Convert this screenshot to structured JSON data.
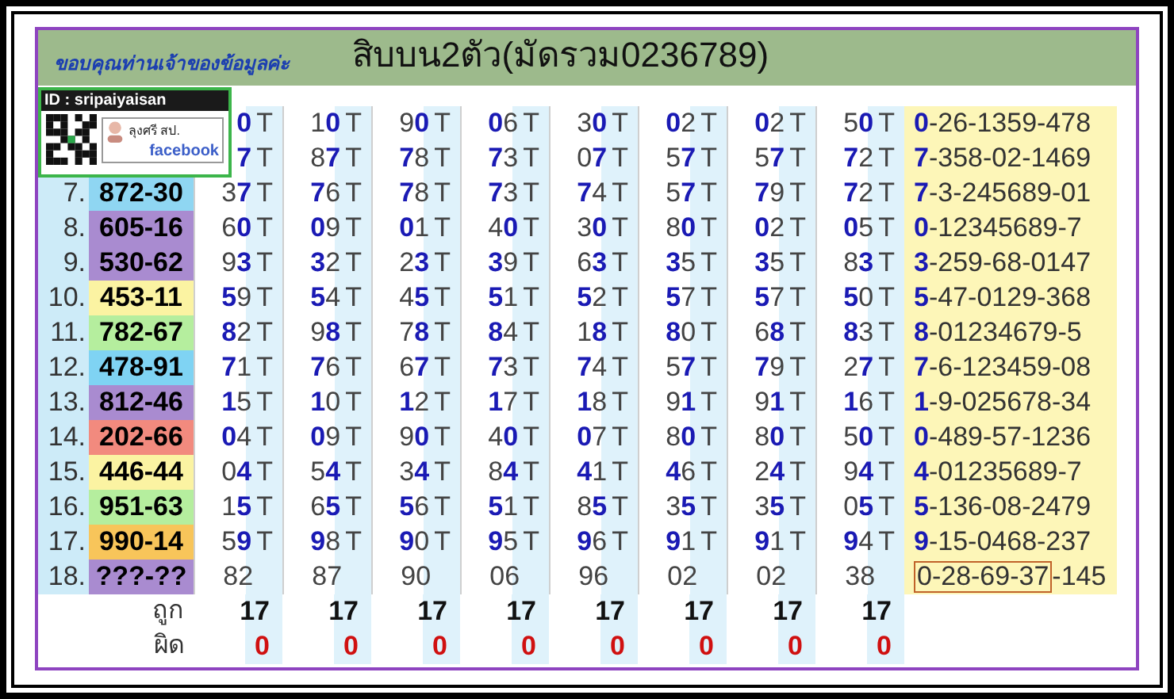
{
  "header": {
    "credit": "ขอบคุณท่านเจ้าของข้อมูลค่ะ",
    "title": "สิบบน2ตัว(มัดรวม0236789)"
  },
  "badge": {
    "id": "ID : sripaiyaisan",
    "name": "ลุงศรี สป.",
    "network": "facebook"
  },
  "rows": [
    {
      "cells": [
        {
          "text": "**0**",
          "mark": "T"
        },
        {
          "text": "1**0**",
          "mark": "T"
        },
        {
          "text": "9**0**",
          "mark": "T"
        },
        {
          "text": "**0**6",
          "mark": "T"
        },
        {
          "text": "3**0**",
          "mark": "T"
        },
        {
          "text": "**0**2",
          "mark": "T"
        },
        {
          "text": "**0**2",
          "mark": "T"
        },
        {
          "text": "5**0**",
          "mark": "T"
        }
      ],
      "result": "**0**-26-1359-478"
    },
    {
      "cells": [
        {
          "text": "**7**",
          "mark": "T"
        },
        {
          "text": "8**7**",
          "mark": "T"
        },
        {
          "text": "**7**8",
          "mark": "T"
        },
        {
          "text": "**7**3",
          "mark": "T"
        },
        {
          "text": "0**7**",
          "mark": "T"
        },
        {
          "text": "5**7**",
          "mark": "T"
        },
        {
          "text": "5**7**",
          "mark": "T"
        },
        {
          "text": "**7**2",
          "mark": "T"
        }
      ],
      "result": "**7**-358-02-1469"
    },
    {
      "index": "7.",
      "number": "872-30",
      "color": "#8fd6f2",
      "cells": [
        {
          "text": "3**7**",
          "mark": "T"
        },
        {
          "text": "**7**6",
          "mark": "T"
        },
        {
          "text": "**7**8",
          "mark": "T"
        },
        {
          "text": "**7**3",
          "mark": "T"
        },
        {
          "text": "**7**4",
          "mark": "T"
        },
        {
          "text": "5**7**",
          "mark": "T"
        },
        {
          "text": "**7**9",
          "mark": "T"
        },
        {
          "text": "**7**2",
          "mark": "T"
        }
      ],
      "result": "**7**-3-245689-01"
    },
    {
      "index": "8.",
      "number": "605-16",
      "color": "#a98bd0",
      "cells": [
        {
          "text": "6**0**",
          "mark": "T"
        },
        {
          "text": "**0**9",
          "mark": "T"
        },
        {
          "text": "**0**1",
          "mark": "T"
        },
        {
          "text": "4**0**",
          "mark": "T"
        },
        {
          "text": "3**0**",
          "mark": "T"
        },
        {
          "text": "8**0**",
          "mark": "T"
        },
        {
          "text": "**0**2",
          "mark": "T"
        },
        {
          "text": "**0**5",
          "mark": "T"
        }
      ],
      "result": "**0**-12345689-7"
    },
    {
      "index": "9.",
      "number": "530-62",
      "color": "#a98bd0",
      "cells": [
        {
          "text": "9**3**",
          "mark": "T"
        },
        {
          "text": "**3**2",
          "mark": "T"
        },
        {
          "text": "2**3**",
          "mark": "T"
        },
        {
          "text": "**3**9",
          "mark": "T"
        },
        {
          "text": "6**3**",
          "mark": "T"
        },
        {
          "text": "**3**5",
          "mark": "T"
        },
        {
          "text": "**3**5",
          "mark": "T"
        },
        {
          "text": "8**3**",
          "mark": "T"
        }
      ],
      "result": "**3**-259-68-0147"
    },
    {
      "index": "10.",
      "number": "453-11",
      "color": "#fbf3a2",
      "cells": [
        {
          "text": "**5**9",
          "mark": "T"
        },
        {
          "text": "**5**4",
          "mark": "T"
        },
        {
          "text": "4**5**",
          "mark": "T"
        },
        {
          "text": "**5**1",
          "mark": "T"
        },
        {
          "text": "**5**2",
          "mark": "T"
        },
        {
          "text": "**5**7",
          "mark": "T"
        },
        {
          "text": "**5**7",
          "mark": "T"
        },
        {
          "text": "**5**0",
          "mark": "T"
        }
      ],
      "result": "**5**-47-0129-368"
    },
    {
      "index": "11.",
      "number": "782-67",
      "color": "#b5ee9e",
      "cells": [
        {
          "text": "**8**2",
          "mark": "T"
        },
        {
          "text": "9**8**",
          "mark": "T"
        },
        {
          "text": "7**8**",
          "mark": "T"
        },
        {
          "text": "**8**4",
          "mark": "T"
        },
        {
          "text": "1**8**",
          "mark": "T"
        },
        {
          "text": "**8**0",
          "mark": "T"
        },
        {
          "text": "6**8**",
          "mark": "T"
        },
        {
          "text": "**8**3",
          "mark": "T"
        }
      ],
      "result": "**8**-01234679-5"
    },
    {
      "index": "12.",
      "number": "478-91",
      "color": "#7fd3f3",
      "cells": [
        {
          "text": "**7**1",
          "mark": "T"
        },
        {
          "text": "**7**6",
          "mark": "T"
        },
        {
          "text": "6**7**",
          "mark": "T"
        },
        {
          "text": "**7**3",
          "mark": "T"
        },
        {
          "text": "**7**4",
          "mark": "T"
        },
        {
          "text": "5**7**",
          "mark": "T"
        },
        {
          "text": "**7**9",
          "mark": "T"
        },
        {
          "text": "2**7**",
          "mark": "T"
        }
      ],
      "result": "**7**-6-123459-08"
    },
    {
      "index": "13.",
      "number": "812-46",
      "color": "#a98bd0",
      "cells": [
        {
          "text": "**1**5",
          "mark": "T"
        },
        {
          "text": "**1**0",
          "mark": "T"
        },
        {
          "text": "**1**2",
          "mark": "T"
        },
        {
          "text": "**1**7",
          "mark": "T"
        },
        {
          "text": "**1**8",
          "mark": "T"
        },
        {
          "text": "9**1**",
          "mark": "T"
        },
        {
          "text": "9**1**",
          "mark": "T"
        },
        {
          "text": "**1**6",
          "mark": "T"
        }
      ],
      "result": "**1**-9-025678-34"
    },
    {
      "index": "14.",
      "number": "202-66",
      "color": "#f28a7e",
      "cells": [
        {
          "text": "**0**4",
          "mark": "T"
        },
        {
          "text": "**0**9",
          "mark": "T"
        },
        {
          "text": "9**0**",
          "mark": "T"
        },
        {
          "text": "4**0**",
          "mark": "T"
        },
        {
          "text": "**0**7",
          "mark": "T"
        },
        {
          "text": "8**0**",
          "mark": "T"
        },
        {
          "text": "8**0**",
          "mark": "T"
        },
        {
          "text": "5**0**",
          "mark": "T"
        }
      ],
      "result": "**0**-489-57-1236"
    },
    {
      "index": "15.",
      "number": "446-44",
      "color": "#fbf3a2",
      "cells": [
        {
          "text": "0**4**",
          "mark": "T"
        },
        {
          "text": "5**4**",
          "mark": "T"
        },
        {
          "text": "3**4**",
          "mark": "T"
        },
        {
          "text": "8**4**",
          "mark": "T"
        },
        {
          "text": "**4**1",
          "mark": "T"
        },
        {
          "text": "**4**6",
          "mark": "T"
        },
        {
          "text": "2**4**",
          "mark": "T"
        },
        {
          "text": "9**4**",
          "mark": "T"
        }
      ],
      "result": "**4**-01235689-7"
    },
    {
      "index": "16.",
      "number": "951-63",
      "color": "#b5ee9e",
      "cells": [
        {
          "text": "1**5**",
          "mark": "T"
        },
        {
          "text": "6**5**",
          "mark": "T"
        },
        {
          "text": "**5**6",
          "mark": "T"
        },
        {
          "text": "**5**1",
          "mark": "T"
        },
        {
          "text": "8**5**",
          "mark": "T"
        },
        {
          "text": "3**5**",
          "mark": "T"
        },
        {
          "text": "3**5**",
          "mark": "T"
        },
        {
          "text": "0**5**",
          "mark": "T"
        }
      ],
      "result": "**5**-136-08-2479"
    },
    {
      "index": "17.",
      "number": "990-14",
      "color": "#f8c55a",
      "cells": [
        {
          "text": "5**9**",
          "mark": "T"
        },
        {
          "text": "**9**8",
          "mark": "T"
        },
        {
          "text": "**9**0",
          "mark": "T"
        },
        {
          "text": "**9**5",
          "mark": "T"
        },
        {
          "text": "**9**6",
          "mark": "T"
        },
        {
          "text": "**9**1",
          "mark": "T"
        },
        {
          "text": "**9**1",
          "mark": "T"
        },
        {
          "text": "**9**4",
          "mark": "T"
        }
      ],
      "result": "**9**-15-0468-237"
    },
    {
      "index": "18.",
      "number": "???-??",
      "color": "#a98bd0",
      "cells": [
        {
          "text": "82"
        },
        {
          "text": "87"
        },
        {
          "text": "90"
        },
        {
          "text": "06"
        },
        {
          "text": "96"
        },
        {
          "text": "02"
        },
        {
          "text": "02"
        },
        {
          "text": "38"
        }
      ],
      "result_boxed": "0-28-69-37",
      "result": "-145"
    }
  ],
  "totals": [
    {
      "label": "ถูก",
      "kind": "right",
      "values": [
        "17",
        "17",
        "17",
        "17",
        "17",
        "17",
        "17",
        "17"
      ]
    },
    {
      "label": "ผิด",
      "kind": "wrong",
      "values": [
        "0",
        "0",
        "0",
        "0",
        "0",
        "0",
        "0",
        "0"
      ]
    }
  ]
}
